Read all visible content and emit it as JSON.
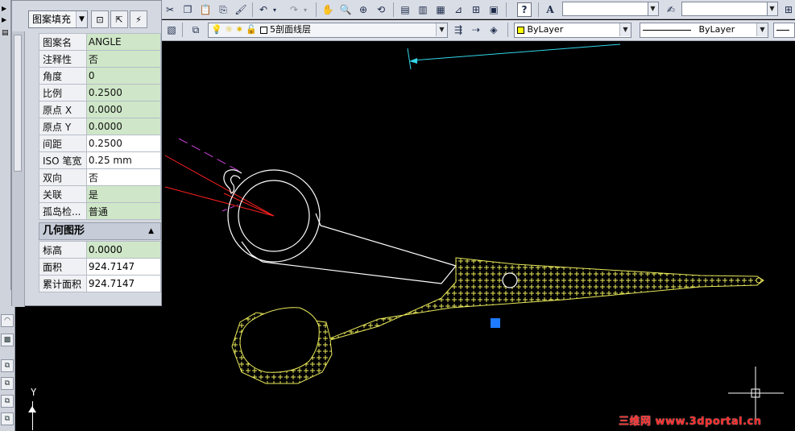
{
  "toolbar_top": {
    "layer_combo": "",
    "style_combo": ""
  },
  "toolbar_layer": {
    "layer_name": "5剖面线层",
    "color_combo": "ByLayer",
    "linetype_combo": "ByLayer"
  },
  "properties": {
    "object_type": "图案填充",
    "pattern_rows": [
      {
        "key": "图案名",
        "value": "ANGLE"
      },
      {
        "key": "注释性",
        "value": "否"
      },
      {
        "key": "角度",
        "value": "0"
      },
      {
        "key": "比例",
        "value": "0.2500"
      },
      {
        "key": "原点 X",
        "value": "0.0000"
      },
      {
        "key": "原点 Y",
        "value": "0.0000"
      },
      {
        "key": "间距",
        "value": "0.2500"
      },
      {
        "key": "ISO 笔宽",
        "value": "0.25 mm"
      },
      {
        "key": "双向",
        "value": "否"
      },
      {
        "key": "关联",
        "value": "是"
      },
      {
        "key": "孤岛检...",
        "value": "普通"
      }
    ],
    "geometry_section": "几何图形",
    "geometry_rows": [
      {
        "key": "标高",
        "value": "0.0000"
      },
      {
        "key": "面积",
        "value": "924.7147"
      },
      {
        "key": "累计面积",
        "value": "924.7147"
      }
    ]
  },
  "canvas": {
    "y_axis_label": "Y",
    "watermark": "三维网 www.3dportal.cn"
  },
  "colors": {
    "canvas_bg": "#000000",
    "hatch": "#e8e85a",
    "outline": "#ffffff",
    "grip": "#1e7bff",
    "cyan_line": "#33d6e8",
    "red_line": "#ff2020",
    "magenta_line": "#d040e0",
    "color_swatch": "#ffff00"
  }
}
